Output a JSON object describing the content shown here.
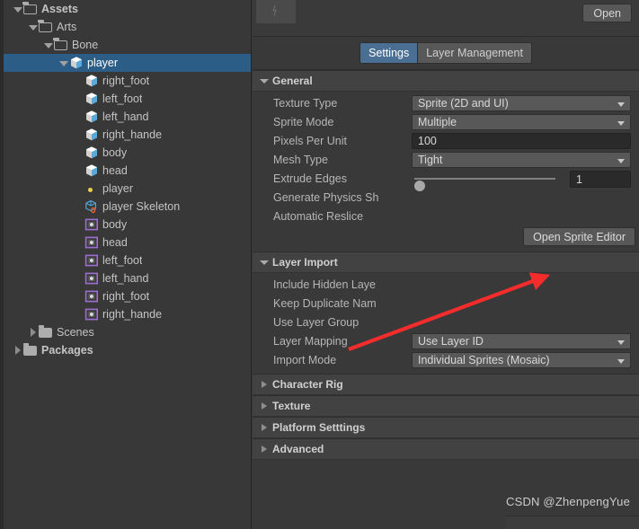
{
  "project_tree": {
    "rows": [
      {
        "label": "Assets",
        "indent": 0,
        "icon": "folder-open-icon",
        "twisty": "open",
        "bold": true,
        "selected": false
      },
      {
        "label": "Arts",
        "indent": 1,
        "icon": "folder-open-icon",
        "twisty": "open",
        "bold": false,
        "selected": false
      },
      {
        "label": "Bone",
        "indent": 2,
        "icon": "folder-open-icon",
        "twisty": "open",
        "bold": false,
        "selected": false
      },
      {
        "label": "player",
        "indent": 3,
        "icon": "prefab-icon",
        "twisty": "open",
        "bold": false,
        "selected": true
      },
      {
        "label": "right_foot",
        "indent": 4,
        "icon": "prefab-icon",
        "twisty": "none",
        "bold": false,
        "selected": false
      },
      {
        "label": "left_foot",
        "indent": 4,
        "icon": "prefab-icon",
        "twisty": "none",
        "bold": false,
        "selected": false
      },
      {
        "label": "left_hand",
        "indent": 4,
        "icon": "prefab-icon",
        "twisty": "none",
        "bold": false,
        "selected": false
      },
      {
        "label": "right_hande",
        "indent": 4,
        "icon": "prefab-icon",
        "twisty": "none",
        "bold": false,
        "selected": false
      },
      {
        "label": "body",
        "indent": 4,
        "icon": "prefab-icon",
        "twisty": "none",
        "bold": false,
        "selected": false
      },
      {
        "label": "head",
        "indent": 4,
        "icon": "prefab-icon",
        "twisty": "none",
        "bold": false,
        "selected": false
      },
      {
        "label": "player",
        "indent": 4,
        "icon": "yellow-dot-icon",
        "twisty": "none",
        "bold": false,
        "selected": false
      },
      {
        "label": "player Skeleton",
        "indent": 4,
        "icon": "skeleton-icon",
        "twisty": "none",
        "bold": false,
        "selected": false
      },
      {
        "label": "body",
        "indent": 4,
        "icon": "sprite-icon",
        "twisty": "none",
        "bold": false,
        "selected": false
      },
      {
        "label": "head",
        "indent": 4,
        "icon": "sprite-icon",
        "twisty": "none",
        "bold": false,
        "selected": false
      },
      {
        "label": "left_foot",
        "indent": 4,
        "icon": "sprite-icon",
        "twisty": "none",
        "bold": false,
        "selected": false
      },
      {
        "label": "left_hand",
        "indent": 4,
        "icon": "sprite-icon",
        "twisty": "none",
        "bold": false,
        "selected": false
      },
      {
        "label": "right_foot",
        "indent": 4,
        "icon": "sprite-icon",
        "twisty": "none",
        "bold": false,
        "selected": false
      },
      {
        "label": "right_hande",
        "indent": 4,
        "icon": "sprite-icon",
        "twisty": "none",
        "bold": false,
        "selected": false
      },
      {
        "label": "Scenes",
        "indent": 1,
        "icon": "folder-icon",
        "twisty": "closed",
        "bold": false,
        "selected": false
      },
      {
        "label": "Packages",
        "indent": 0,
        "icon": "folder-icon",
        "twisty": "closed",
        "bold": true,
        "selected": false
      }
    ]
  },
  "inspector": {
    "open_button": "Open",
    "tabs": [
      {
        "label": "Settings",
        "active": true
      },
      {
        "label": "Layer Management",
        "active": false
      }
    ],
    "general": {
      "title": "General",
      "texture_type": {
        "label": "Texture Type",
        "value": "Sprite (2D and UI)"
      },
      "sprite_mode": {
        "label": "Sprite Mode",
        "value": "Multiple"
      },
      "pixels_per_unit": {
        "label": "Pixels Per Unit",
        "value": "100"
      },
      "mesh_type": {
        "label": "Mesh Type",
        "value": "Tight"
      },
      "extrude_edges": {
        "label": "Extrude Edges",
        "value": "1",
        "slider_percent": 0
      },
      "generate_physics_shape": {
        "label": "Generate Physics Sh",
        "checked": false
      },
      "automatic_reslice": {
        "label": "Automatic Reslice",
        "checked": false
      },
      "open_sprite_editor": "Open Sprite Editor"
    },
    "layer_import": {
      "title": "Layer Import",
      "include_hidden_layers": {
        "label": "Include Hidden Laye",
        "checked": false
      },
      "keep_duplicate_names": {
        "label": "Keep Duplicate Nam",
        "checked": true
      },
      "use_layer_group": {
        "label": "Use Layer Group",
        "checked": false
      },
      "layer_mapping": {
        "label": "Layer Mapping",
        "value": "Use Layer ID"
      },
      "import_mode": {
        "label": "Import Mode",
        "value": "Individual Sprites (Mosaic)"
      }
    },
    "collapsed_sections": [
      {
        "label": "Character Rig"
      },
      {
        "label": "Texture"
      },
      {
        "label": "Platform Setttings"
      },
      {
        "label": "Advanced"
      }
    ]
  },
  "annotation": {
    "arrow_color": "#f42c2c",
    "watermark": "CSDN @ZhenpengYue"
  }
}
